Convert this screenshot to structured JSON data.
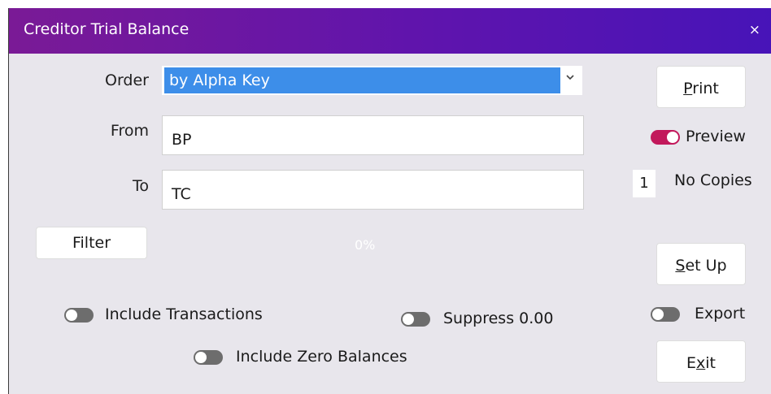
{
  "window": {
    "title": "Creditor Trial Balance",
    "close_glyph": "×"
  },
  "form": {
    "order_label": "Order",
    "order_value": "by Alpha Key",
    "from_label": "From",
    "from_value": "BP",
    "to_label": "To",
    "to_value": "TC"
  },
  "buttons": {
    "filter": "Filter",
    "print_u": "P",
    "print_rest": "rint",
    "setup_u": "S",
    "setup_rest": "et Up",
    "exit_a": "E",
    "exit_u": "x",
    "exit_c": "it"
  },
  "progress": {
    "text": "0%"
  },
  "toggles": {
    "preview": {
      "label": "Preview",
      "on": true
    },
    "include_transactions": {
      "label": "Include Transactions",
      "on": false
    },
    "suppress_zero": {
      "label": "Suppress 0.00",
      "on": false
    },
    "include_zero_balances": {
      "label": "Include Zero Balances",
      "on": false
    },
    "export": {
      "label": "Export",
      "on": false
    }
  },
  "copies": {
    "value": "1",
    "label": "No Copies"
  },
  "colors": {
    "accent": "#3d8ee9",
    "toggle_on": "#c2185b",
    "titlebar": "#6a17a6"
  },
  "icons": {
    "dropdown": "chevron-down-icon",
    "close": "close-icon"
  }
}
